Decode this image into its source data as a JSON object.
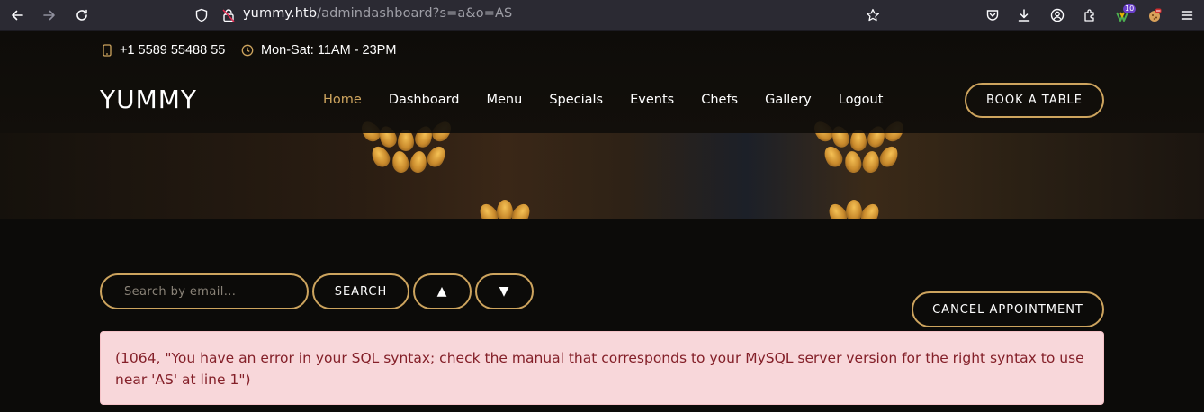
{
  "browser": {
    "url_host": "yummy.htb",
    "url_path": "/admindashboard?s=a&o=AS",
    "extension_badge": "10"
  },
  "topbar": {
    "phone": "+1 5589 55488 55",
    "hours": "Mon-Sat: 11AM - 23PM"
  },
  "site": {
    "logo": "YUMMY",
    "nav": [
      "Home",
      "Dashboard",
      "Menu",
      "Specials",
      "Events",
      "Chefs",
      "Gallery",
      "Logout"
    ],
    "book_table": "BOOK A TABLE"
  },
  "dashboard": {
    "search_placeholder": "Search by email...",
    "search_label": "SEARCH",
    "sort_asc_label": "▲",
    "sort_desc_label": "▼",
    "cancel_label": "CANCEL APPOINTMENT",
    "error_message": "(1064, \"You have an error in your SQL syntax; check the manual that corresponds to your MySQL server version for the right syntax to use near 'AS' at line 1\")"
  },
  "colors": {
    "accent": "#cda45e",
    "alert_bg": "#f8d7da",
    "alert_text": "#842029",
    "browser_bg": "#2b2a33"
  }
}
